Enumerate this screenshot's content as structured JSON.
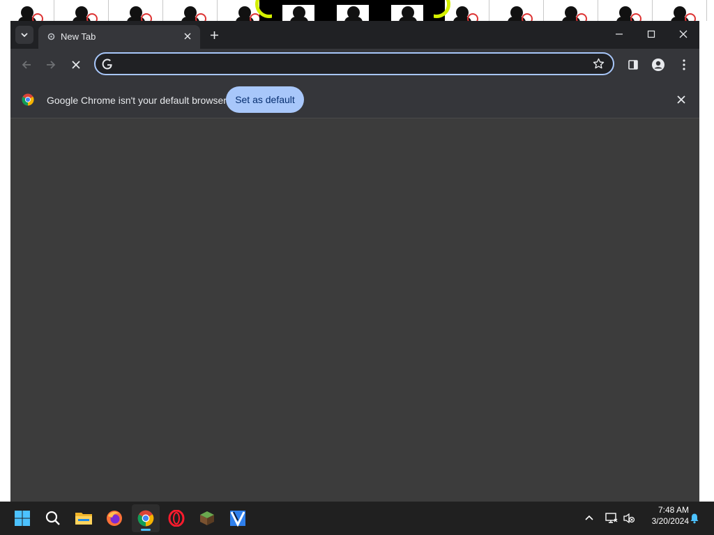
{
  "browser": {
    "tab_title": "New Tab",
    "omnibox_value": "",
    "infobar_message": "Google Chrome isn't your default browser",
    "set_default_label": "Set as default",
    "accent": "#a8c7fa"
  },
  "taskbar": {
    "apps": [
      "start-icon",
      "search-icon",
      "file-explorer-icon",
      "firefox-icon",
      "chrome-icon",
      "opera-icon",
      "minecraft-icon",
      "app-icon"
    ],
    "time": "7:48 AM",
    "date": "3/20/2024"
  },
  "colors": {
    "tabstrip_bg": "#202124",
    "toolbar_bg": "#35363a",
    "content_bg": "#3c3c3c",
    "taskbar_bg": "#202020"
  }
}
